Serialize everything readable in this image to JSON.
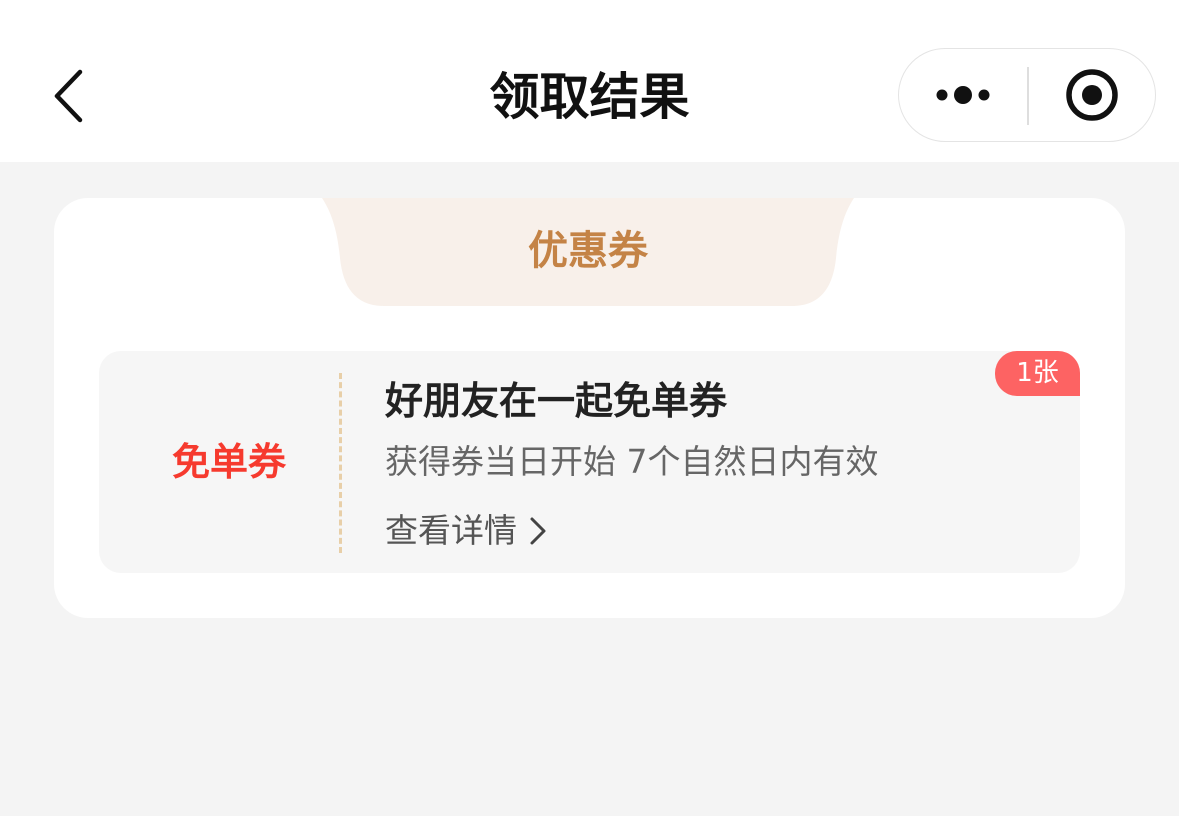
{
  "nav": {
    "title": "领取结果",
    "back_icon": "chevron-left-icon",
    "more_icon": "more-dots-icon",
    "close_icon": "target-circle-icon"
  },
  "section": {
    "tab_label": "优惠券"
  },
  "coupon": {
    "type_label": "免单券",
    "name": "好朋友在一起免单券",
    "validity": "获得券当日开始 7个自然日内有效",
    "detail_label": "查看详情",
    "count_badge": "1张"
  },
  "colors": {
    "page_background": "#f4f4f4",
    "tab_text": "#c48346",
    "tab_background": "#f8f0ea",
    "coupon_type": "#f63a2e",
    "badge_background": "#fd6363",
    "dashed_divider": "#e8cfa8"
  }
}
